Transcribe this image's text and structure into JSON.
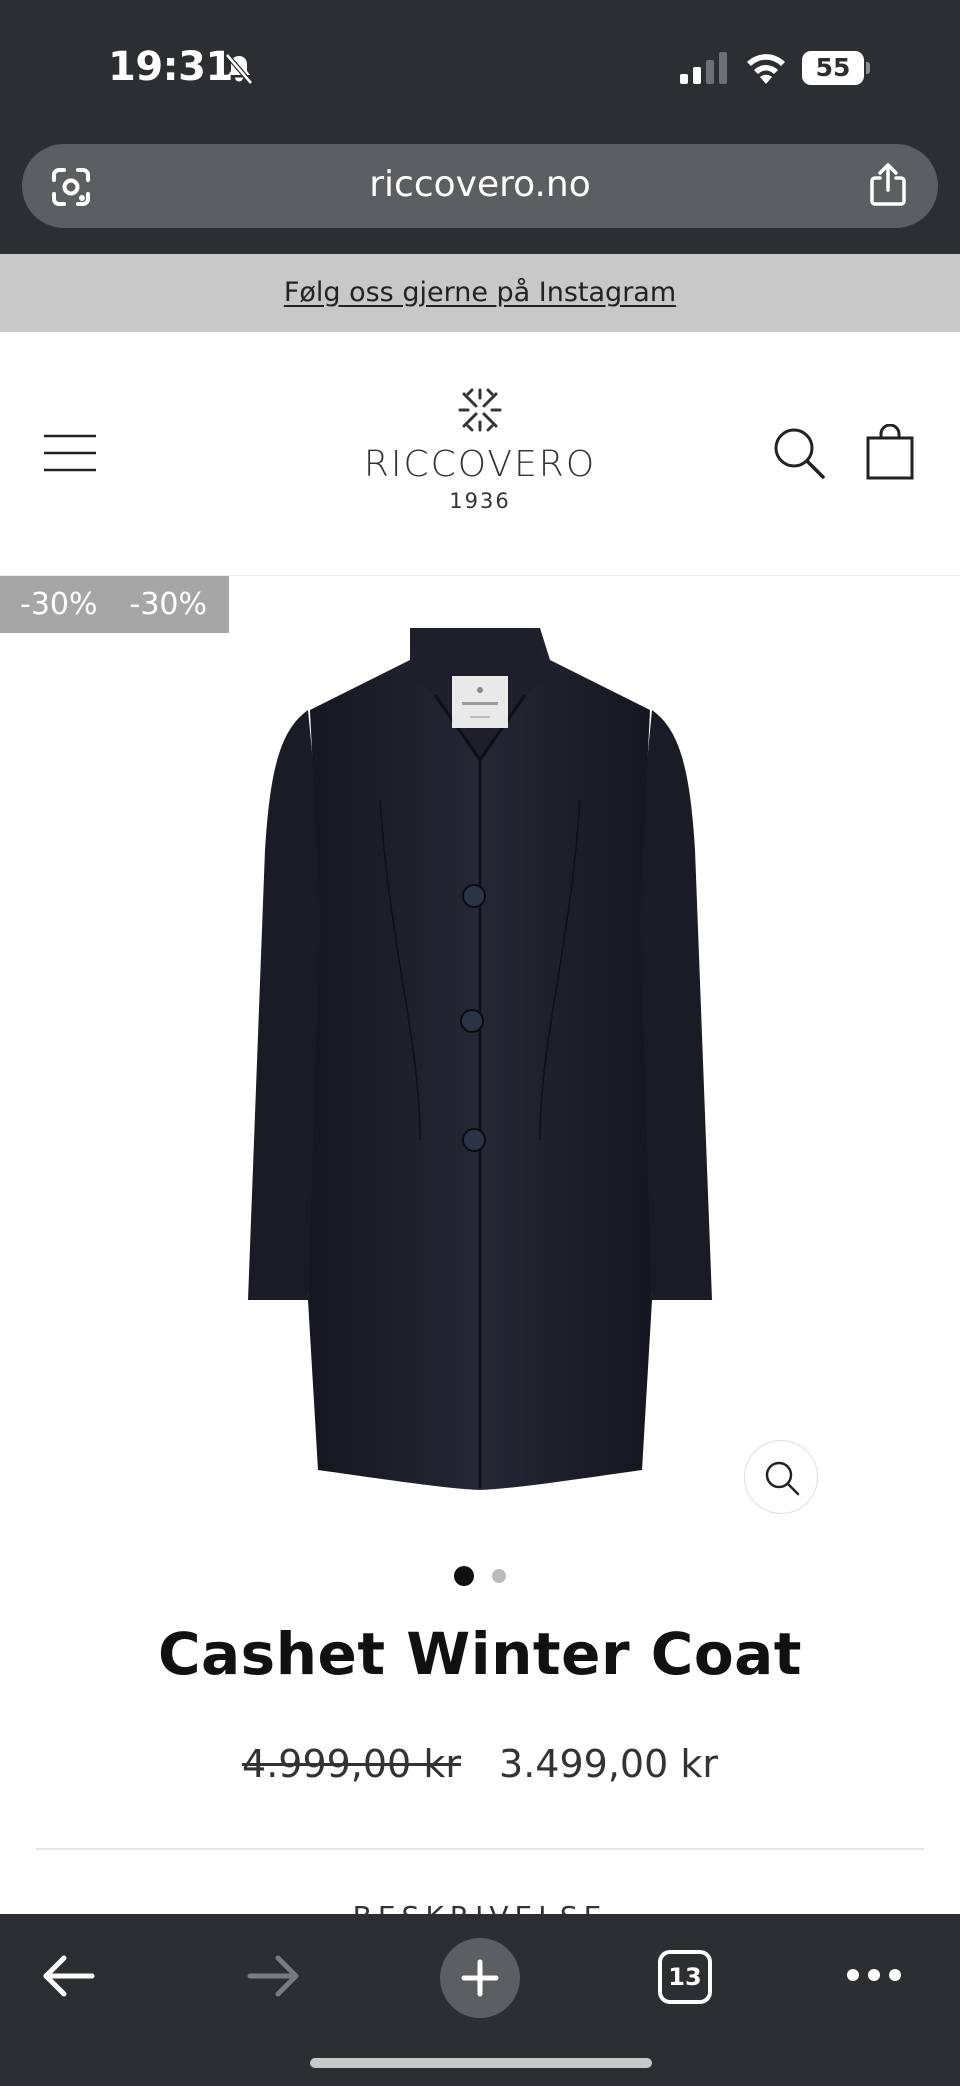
{
  "status_bar": {
    "time": "19:31",
    "battery": "55",
    "icons": [
      "bell-slash-icon",
      "cellular-signal-icon",
      "wifi-icon",
      "battery-icon"
    ]
  },
  "browser": {
    "url": "riccovero.no",
    "icons": [
      "google-lens-icon",
      "share-icon"
    ],
    "toolbar": {
      "tab_count": "13",
      "icons": [
        "back-arrow-icon",
        "forward-arrow-icon",
        "new-tab-plus-icon",
        "tab-switcher-icon",
        "more-dots-icon"
      ]
    }
  },
  "announcement": {
    "text": "Følg oss gjerne på Instagram"
  },
  "header": {
    "logo_name": "RICCOVERO",
    "logo_year": "1936",
    "icons": [
      "hamburger-menu-icon",
      "riccovero-logo-mark",
      "search-icon",
      "shopping-bag-icon"
    ]
  },
  "product": {
    "badges": [
      "-30%",
      "-30%"
    ],
    "title": "Cashet Winter Coat",
    "price_original": "4.999,00 kr",
    "price_sale": "3.499,00 kr",
    "image_count": 2,
    "active_image": 1,
    "next_section_label": "BESKRIVELSE",
    "colors": {
      "coat": "#1c1e29",
      "badge_bg": "#a6a6a6"
    }
  }
}
